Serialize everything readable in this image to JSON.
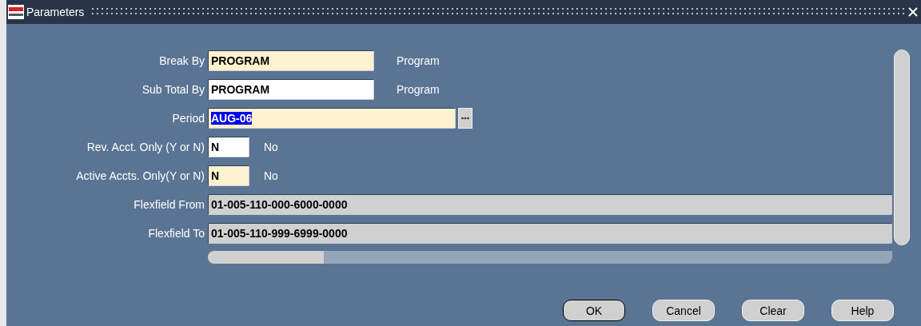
{
  "window": {
    "title": "Parameters"
  },
  "fields": [
    {
      "label": "Break By",
      "value": "PROGRAM",
      "kind": "required",
      "text_selected": false,
      "list_button": false,
      "description": "Program"
    },
    {
      "label": "Sub Total By",
      "value": "PROGRAM",
      "kind": "optional",
      "text_selected": false,
      "list_button": false,
      "description": "Program"
    },
    {
      "label": "Period",
      "value": "AUG-06",
      "kind": "required",
      "text_selected": true,
      "list_button": true
    },
    {
      "label": "Rev. Acct. Only (Y or N)",
      "value": "N",
      "kind": "optional",
      "text_selected": false,
      "list_button": false,
      "description": "No"
    },
    {
      "label": "Active Accts. Only(Y or N)",
      "value": "N",
      "kind": "required",
      "text_selected": false,
      "list_button": false,
      "description": "No"
    },
    {
      "label": "Flexfield From",
      "value": "01-005-110-000-6000-0000",
      "kind": "readonly",
      "text_selected": false,
      "list_button": false
    },
    {
      "label": "Flexfield To",
      "value": "01-005-110-999-6999-0000",
      "kind": "readonly",
      "text_selected": false,
      "list_button": false
    }
  ],
  "buttons": [
    {
      "label": "OK",
      "default": true
    },
    {
      "label": "Cancel",
      "default": false
    },
    {
      "label": "Clear",
      "default": false
    },
    {
      "label": "Help",
      "default": false
    }
  ]
}
